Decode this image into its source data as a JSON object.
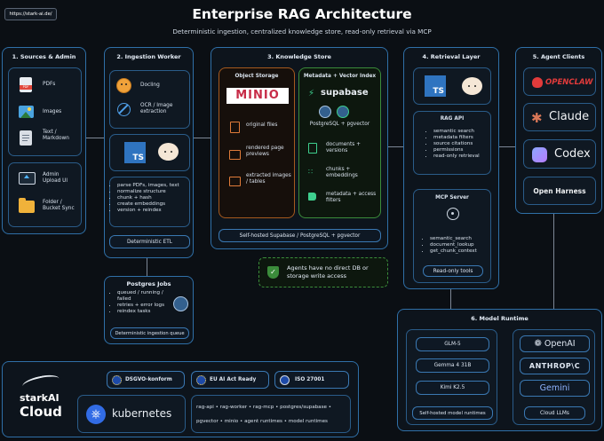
{
  "url_badge": "https://stark-ai.de/",
  "title": "Enterprise RAG Architecture",
  "subtitle": "Deterministic ingestion, centralized knowledge store, read-only retrieval via MCP",
  "sources": {
    "title": "1. Sources & Admin",
    "items": [
      "PDFs",
      "Images",
      "Text / Markdown"
    ],
    "admin": [
      "Admin Upload UI",
      "Folder / Bucket Sync"
    ]
  },
  "ingestion": {
    "title": "2. Ingestion Worker",
    "tools": [
      "Docling",
      "OCR / Image extraction"
    ],
    "steps": [
      "parse PDFs, images, text",
      "normalize structure",
      "chunk + hash",
      "create embeddings",
      "version + reindex"
    ],
    "footer": "Deterministic ETL"
  },
  "jobs": {
    "title": "Postgres Jobs",
    "items": [
      "queued / running / failed",
      "retries + error logs",
      "reindex tasks"
    ],
    "footer": "Deterministic ingestion queue"
  },
  "knowledge": {
    "title": "3. Knowledge Store",
    "object_storage": {
      "title": "Object Storage",
      "logo": "MINIO",
      "items": [
        "original files",
        "rendered page previews",
        "extracted images / tables"
      ]
    },
    "metadata": {
      "title": "Metadata + Vector Index",
      "logo": "supabase",
      "engine": "PostgreSQL + pgvector",
      "items": [
        "documents + versions",
        "chunks + embeddings",
        "metadata + access filters"
      ]
    },
    "footer": "Self-hosted Supabase / PostgreSQL + pgvector"
  },
  "security_note": "Agents have no direct DB or storage write access",
  "retrieval": {
    "title": "4. Retrieval Layer",
    "rag_api": {
      "title": "RAG API",
      "items": [
        "semantic search",
        "metadata filters",
        "source citations",
        "permissions",
        "read-only retrieval"
      ]
    },
    "mcp": {
      "title": "MCP Server",
      "items": [
        "semantic_search",
        "document_lookup",
        "get_chunk_context"
      ],
      "footer": "Read-only tools"
    }
  },
  "agents": {
    "title": "5. Agent Clients",
    "items": [
      "OPENCLAW",
      "Claude",
      "Codex",
      "Open Harness"
    ]
  },
  "models": {
    "title": "6. Model Runtime",
    "self_hosted": [
      "GLM-5",
      "Gemma 4 31B",
      "Kimi K2.5"
    ],
    "self_hosted_footer": "Self-hosted model runtimes",
    "cloud": [
      "OpenAI",
      "ANTHROP\\C",
      "Gemini"
    ],
    "cloud_footer": "Cloud LLMs"
  },
  "footer": {
    "brand_top": "starkAI",
    "brand_bottom": "Cloud",
    "badges": [
      "DSGVO-konform",
      "EU AI Act Ready",
      "ISO 27001"
    ],
    "k8s": "kubernetes",
    "services_line1": "rag-api • rag-worker • rag-mcp • postgres/supabase •",
    "services_line2": "pgvector • minio • agent runtimes • model runtimes"
  },
  "colors": {
    "panel_border": "#2f6fa7",
    "minio_red": "#c72c48",
    "supabase_green": "#3ecf8e",
    "ts_blue": "#2f74c0",
    "orange_panel": "#a65a1e",
    "green_panel": "#3b8c3b"
  }
}
